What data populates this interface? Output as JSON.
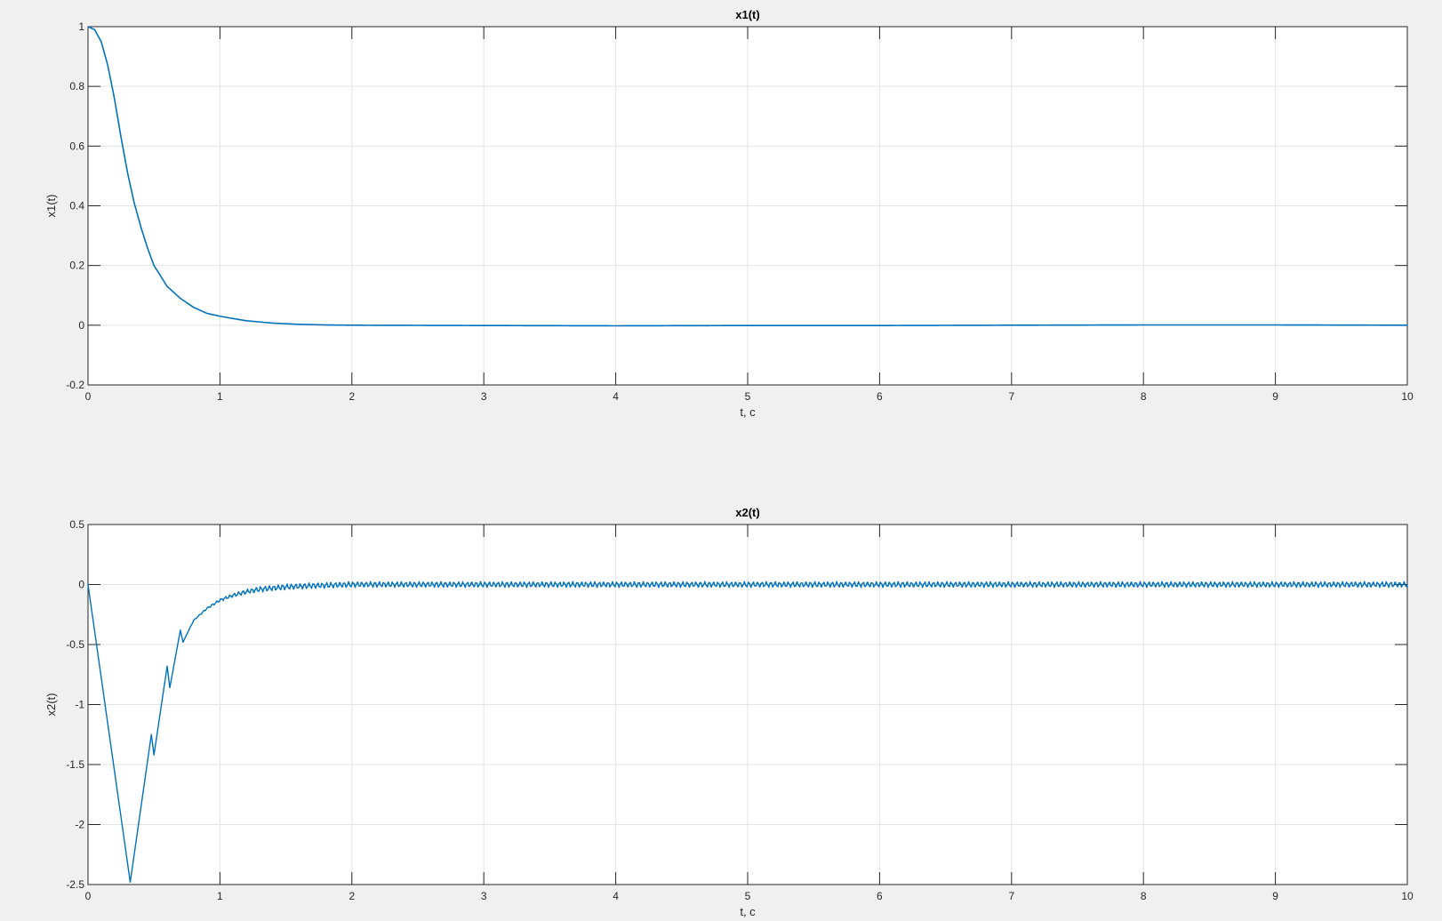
{
  "chart_data": [
    {
      "type": "line",
      "title": "x1(t)",
      "xlabel": "t, c",
      "ylabel": "x1(t)",
      "xlim": [
        0,
        10
      ],
      "ylim": [
        -0.2,
        1
      ],
      "xticks": [
        "0",
        "1",
        "2",
        "3",
        "4",
        "5",
        "6",
        "7",
        "8",
        "9",
        "10"
      ],
      "yticks": [
        "-0.2",
        "0",
        "0.2",
        "0.4",
        "0.6",
        "0.8",
        "1"
      ],
      "grid": true,
      "line_color": "#0072bd",
      "series": [
        {
          "x": [
            0,
            0.05,
            0.1,
            0.15,
            0.2,
            0.25,
            0.3,
            0.35,
            0.4,
            0.45,
            0.5,
            0.6,
            0.7,
            0.8,
            0.9,
            1.0,
            1.2,
            1.4,
            1.6,
            1.8,
            2.0,
            3.0,
            4.0,
            5.0,
            6.0,
            7.0,
            8.0,
            9.0,
            10.0
          ],
          "y": [
            1.0,
            0.99,
            0.95,
            0.87,
            0.76,
            0.63,
            0.51,
            0.41,
            0.33,
            0.26,
            0.2,
            0.13,
            0.09,
            0.06,
            0.04,
            0.03,
            0.015,
            0.007,
            0.003,
            0.001,
            0.0,
            -0.001,
            -0.002,
            -0.001,
            -0.001,
            0.0,
            0.001,
            0.001,
            0.0
          ]
        }
      ]
    },
    {
      "type": "line",
      "title": "x2(t)",
      "xlabel": "t, c",
      "ylabel": "x2(t)",
      "xlim": [
        0,
        10
      ],
      "ylim": [
        -2.5,
        0.5
      ],
      "xticks": [
        "0",
        "1",
        "2",
        "3",
        "4",
        "5",
        "6",
        "7",
        "8",
        "9",
        "10"
      ],
      "yticks": [
        "-2.5",
        "-2",
        "-1.5",
        "-1",
        "-0.5",
        "0",
        "0.5"
      ],
      "grid": true,
      "line_color": "#0072bd",
      "series": [
        {
          "x": [
            0,
            0.32,
            0.48,
            0.5,
            0.6,
            0.62,
            0.7,
            0.72,
            0.8,
            0.9,
            1.0,
            1.1,
            1.2,
            1.3,
            1.5,
            1.7,
            2.0,
            3.0,
            4.0,
            5.0,
            6.0,
            7.0,
            8.0,
            9.0,
            10.0
          ],
          "y": [
            0,
            -2.48,
            -1.25,
            -1.42,
            -0.68,
            -0.86,
            -0.38,
            -0.48,
            -0.3,
            -0.2,
            -0.13,
            -0.09,
            -0.06,
            -0.04,
            -0.02,
            -0.01,
            0.0,
            0.0,
            0.0,
            0.0,
            0.0,
            0.0,
            0.0,
            0.0,
            0.0
          ],
          "ripple_amplitude": 0.025
        }
      ]
    }
  ]
}
